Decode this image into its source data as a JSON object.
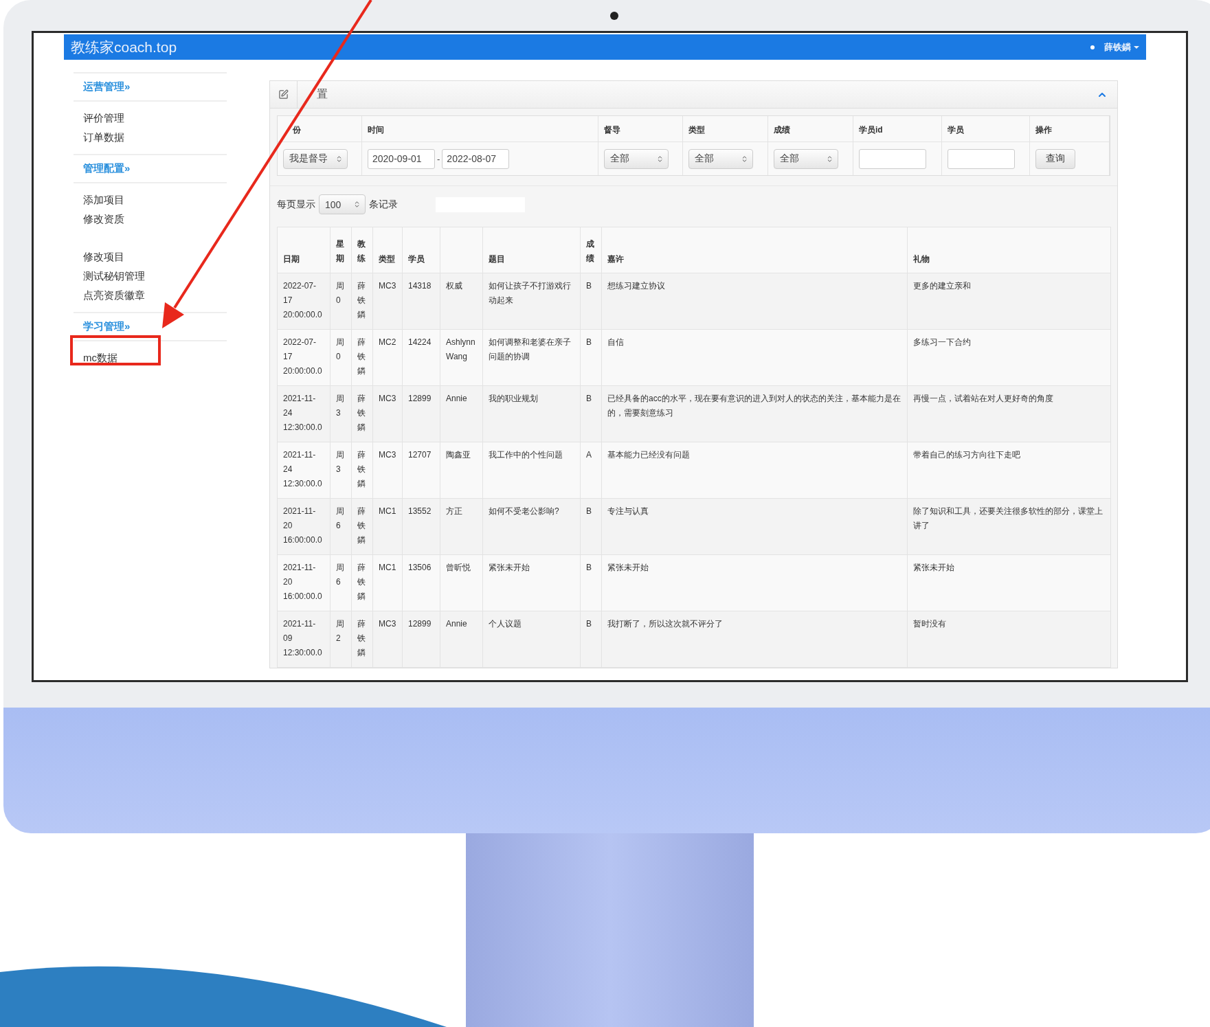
{
  "app": {
    "brand": "教练家coach.top",
    "user": "薛铁鏻"
  },
  "sidebar": {
    "groups": [
      {
        "title": "运营管理»",
        "sections": [
          [
            {
              "label": "评价管理",
              "selected": false
            },
            {
              "label": "订单数据",
              "selected": false
            }
          ]
        ]
      },
      {
        "title": "管理配置»",
        "sections": [
          [
            {
              "label": "添加项目",
              "selected": false
            },
            {
              "label": "修改资质",
              "selected": false
            }
          ],
          [
            {
              "label": "修改项目",
              "selected": false
            },
            {
              "label": "测试秘钥管理",
              "selected": false
            },
            {
              "label": "点亮资质徽章",
              "selected": false
            }
          ]
        ]
      },
      {
        "title": "学习管理»",
        "sections": [
          [
            {
              "label": "mc数据",
              "selected": false
            }
          ]
        ]
      }
    ]
  },
  "panel": {
    "title": "置",
    "filters": [
      {
        "label": "份",
        "kind": "select",
        "value": "我是督导"
      },
      {
        "label": "时间",
        "kind": "daterange",
        "from": "2020-09-01",
        "separator": "-",
        "to": "2022-08-07"
      },
      {
        "label": "督导",
        "kind": "select",
        "value": "全部"
      },
      {
        "label": "类型",
        "kind": "select",
        "value": "全部"
      },
      {
        "label": "成绩",
        "kind": "select",
        "value": "全部"
      },
      {
        "label": "学员id",
        "kind": "input"
      },
      {
        "label": "学员",
        "kind": "input"
      },
      {
        "label": "操作",
        "kind": "button",
        "text": "查询"
      }
    ],
    "page_size": {
      "before": "每页显示",
      "value": "100",
      "after": "条记录"
    },
    "table": {
      "columns": [
        {
          "kind": "text",
          "label": "日期"
        },
        {
          "kind": "vertical",
          "label": "星期"
        },
        {
          "kind": "vertical",
          "label": "教练"
        },
        {
          "kind": "text",
          "label": "类型"
        },
        {
          "kind": "text",
          "label": "学员"
        },
        {
          "kind": "blank"
        },
        {
          "kind": "text",
          "label": "题目"
        },
        {
          "kind": "vertical",
          "label": "成绩"
        },
        {
          "kind": "text",
          "label": "嘉许"
        },
        {
          "kind": "text",
          "label": "礼物"
        }
      ],
      "rows": [
        [
          "2022-07-17 20:00:00.0",
          "周 0",
          "薛铁鏻",
          "MC3",
          "14318",
          "权威",
          "如何让孩子不打游戏行动起来",
          "B",
          "想练习建立协议",
          "更多的建立亲和"
        ],
        [
          "2022-07-17 20:00:00.0",
          "周 0",
          "薛铁鏻",
          "MC2",
          "14224",
          "Ashlynn Wang",
          "如何调整和老婆在亲子问题的协调",
          "B",
          "自信",
          "多练习一下合约"
        ],
        [
          "2021-11-24 12:30:00.0",
          "周 3",
          "薛铁鏻",
          "MC3",
          "12899",
          "Annie",
          "我的职业规划",
          "B",
          "已经具备的acc的水平，现在要有意识的进入到对人的状态的关注，基本能力是在的，需要刻意练习",
          "再慢一点，试着站在对人更好奇的角度"
        ],
        [
          "2021-11-24 12:30:00.0",
          "周 3",
          "薛铁鏻",
          "MC3",
          "12707",
          "陶鑫亚",
          "我工作中的个性问题",
          "A",
          "基本能力已经没有问题",
          "带着自己的练习方向往下走吧"
        ],
        [
          "2021-11-20 16:00:00.0",
          "周 6",
          "薛铁鏻",
          "MC1",
          "13552",
          "方正",
          "如何不受老公影响?",
          "B",
          "专注与认真",
          "除了知识和工具，还要关注很多软性的部分，课堂上讲了"
        ],
        [
          "2021-11-20 16:00:00.0",
          "周 6",
          "薛铁鏻",
          "MC1",
          "13506",
          "曾昕悦",
          "紧张未开始",
          "B",
          "紧张未开始",
          "紧张未开始"
        ],
        [
          "2021-11-09 12:30:00.0",
          "周 2",
          "薛铁鏻",
          "MC3",
          "12899",
          "Annie",
          "个人议题",
          "B",
          "我打断了，所以这次就不评分了",
          "暂时没有"
        ]
      ]
    }
  }
}
